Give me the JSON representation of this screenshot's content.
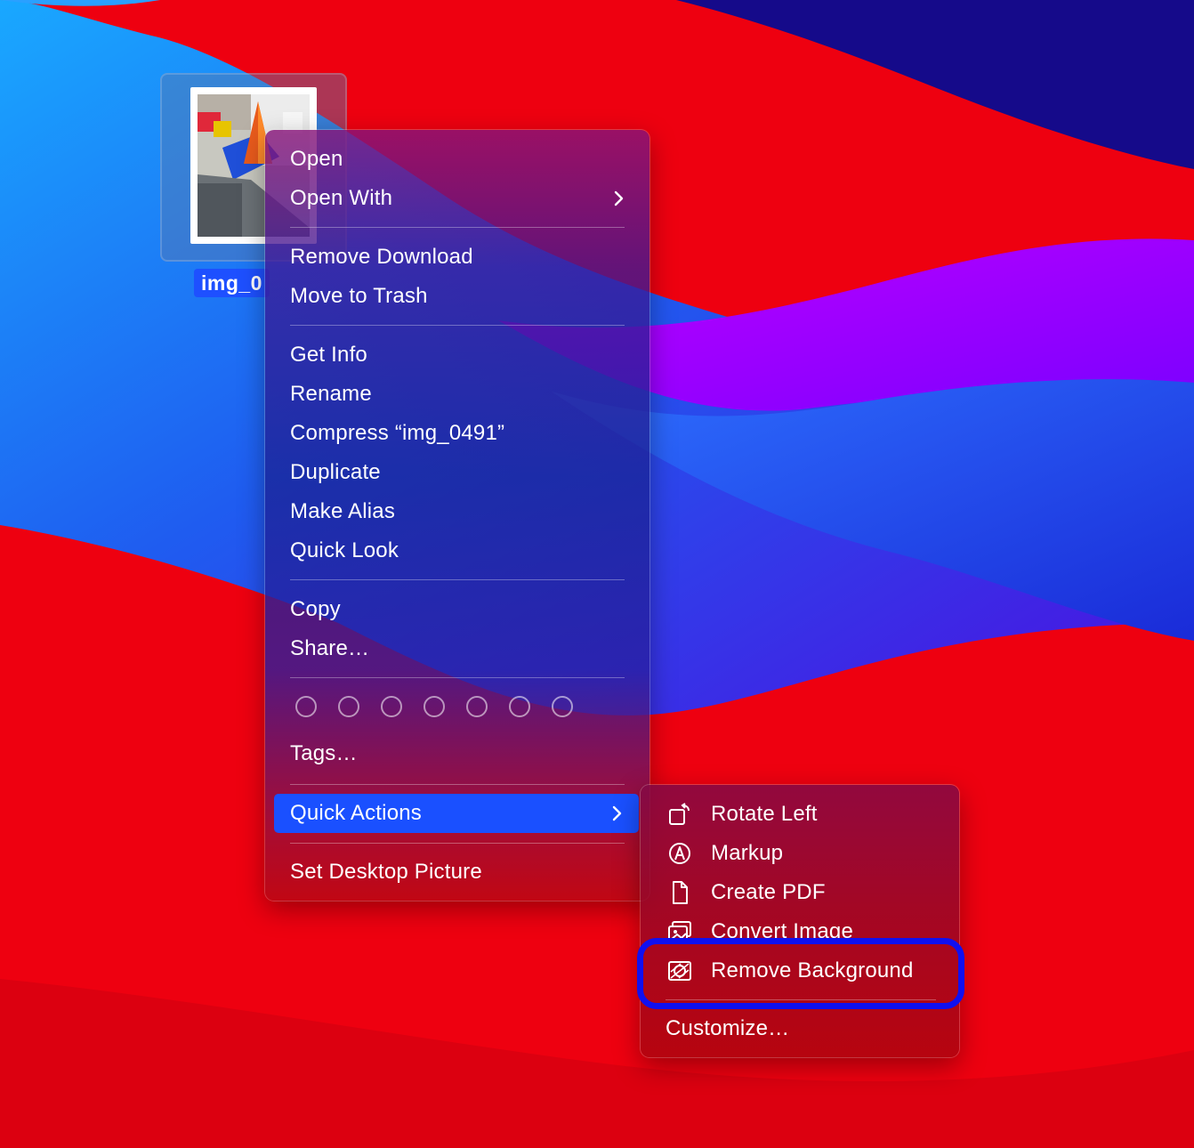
{
  "desktop": {
    "file": {
      "label": "img_0"
    }
  },
  "context_menu": {
    "items": {
      "open": "Open",
      "open_with": "Open With",
      "remove_download": "Remove Download",
      "move_to_trash": "Move to Trash",
      "get_info": "Get Info",
      "rename": "Rename",
      "compress": "Compress “img_0491”",
      "duplicate": "Duplicate",
      "make_alias": "Make Alias",
      "quick_look": "Quick Look",
      "copy": "Copy",
      "share": "Share…",
      "tags": "Tags…",
      "quick_actions": "Quick Actions",
      "set_desktop_picture": "Set Desktop Picture"
    },
    "tag_colors": [
      "none",
      "none",
      "none",
      "none",
      "none",
      "none",
      "none"
    ],
    "active_item": "quick_actions",
    "accent_color": "#1a50ff"
  },
  "quick_actions_submenu": {
    "items": [
      {
        "label": "Rotate Left",
        "icon": "rotate-left-icon"
      },
      {
        "label": "Markup",
        "icon": "markup-icon"
      },
      {
        "label": "Create PDF",
        "icon": "document-icon"
      },
      {
        "label": "Convert Image",
        "icon": "convert-image-icon"
      },
      {
        "label": "Remove Background",
        "icon": "remove-background-icon"
      }
    ],
    "customize": "Customize…",
    "highlighted_item": "Remove Background",
    "highlight_color": "#1010f0"
  }
}
